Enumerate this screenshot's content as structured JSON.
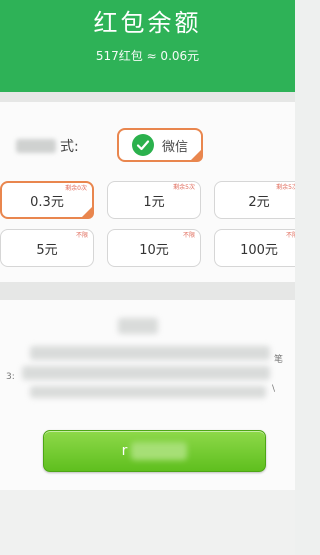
{
  "header": {
    "title": "红包余额",
    "subtitle": "517红包 ≈ 0.06元"
  },
  "payment": {
    "label_suffix": "式:",
    "method": "微信",
    "icon": "wechat-check-icon"
  },
  "amounts": [
    {
      "label": "0.3元",
      "tag": "剩余0次",
      "selected": true
    },
    {
      "label": "1元",
      "tag": "剩余5次",
      "selected": false
    },
    {
      "label": "2元",
      "tag": "剩余5次",
      "selected": false
    },
    {
      "label": "5元",
      "tag": "不限",
      "selected": false
    },
    {
      "label": "10元",
      "tag": "不限",
      "selected": false
    },
    {
      "label": "100元",
      "tag": "不限",
      "selected": false
    }
  ],
  "notes": {
    "line3_prefix": "3:",
    "side_char_1": "笔",
    "side_char_2": "\\"
  },
  "withdraw_button": {
    "glyph": "r"
  },
  "colors": {
    "header_green": "#2eb257",
    "accent_orange": "#e9864e",
    "button_green": "#6cc92e"
  }
}
